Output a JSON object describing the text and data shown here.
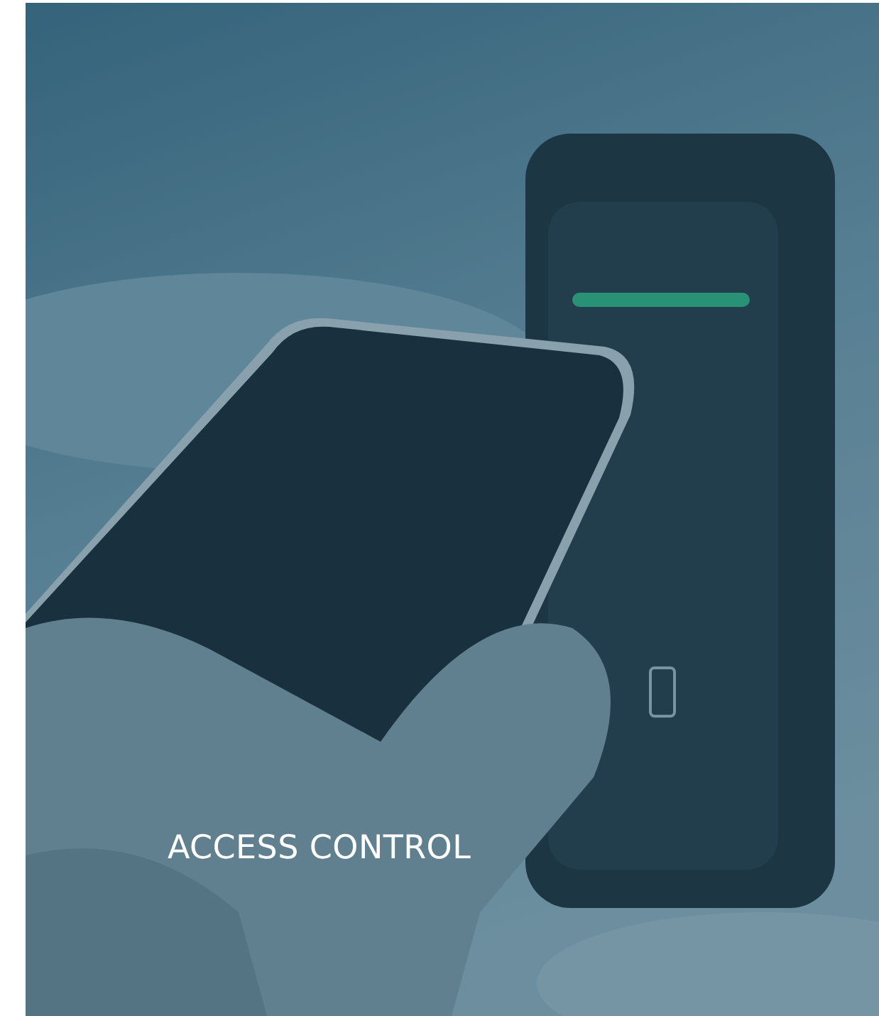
{
  "tile": {
    "title": "ACCESS CONTROL"
  }
}
